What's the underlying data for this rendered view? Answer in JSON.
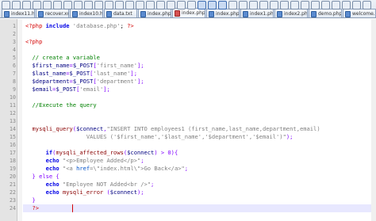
{
  "tabs": [
    {
      "label": "index11.html",
      "active": false,
      "icon": "file-icon"
    },
    {
      "label": "recover.xml",
      "active": false,
      "icon": "file-icon"
    },
    {
      "label": "index10.html",
      "active": false,
      "icon": "file-icon"
    },
    {
      "label": "data.txt",
      "active": false,
      "icon": "file-icon"
    },
    {
      "label": "index.php",
      "active": false,
      "icon": "file-icon"
    },
    {
      "label": "index.php",
      "active": true,
      "icon": "file-icon-modified"
    },
    {
      "label": "index.php",
      "active": false,
      "icon": "file-icon"
    },
    {
      "label": "index1.php",
      "active": false,
      "icon": "file-icon"
    },
    {
      "label": "index2.php",
      "active": false,
      "icon": "file-icon"
    },
    {
      "label": "demo.php",
      "active": false,
      "icon": "file-icon"
    },
    {
      "label": "welcome.php",
      "active": false,
      "icon": "file-icon"
    }
  ],
  "line_numbers": [
    "1",
    "2",
    "3",
    "4",
    "5",
    "6",
    "7",
    "8",
    "9",
    "10",
    "11",
    "12",
    "13",
    "14",
    "15",
    "16",
    "17",
    "18",
    "19",
    "20",
    "21",
    "22",
    "23",
    "24"
  ],
  "code_lines": [
    [
      {
        "t": "<?php ",
        "c": "tag"
      },
      {
        "t": "include ",
        "c": "kw"
      },
      {
        "t": "'database.php'",
        "c": "str"
      },
      {
        "t": "; ",
        "c": ""
      },
      {
        "t": "?>",
        "c": "tag"
      }
    ],
    [],
    [
      {
        "t": "<?php",
        "c": "tag"
      }
    ],
    [],
    [
      {
        "t": "  // create a variable",
        "c": "com"
      }
    ],
    [
      {
        "t": "  $first_name",
        "c": "var"
      },
      {
        "t": "=",
        "c": "op"
      },
      {
        "t": "$_POST",
        "c": "var"
      },
      {
        "t": "[",
        "c": "op"
      },
      {
        "t": "'first_name'",
        "c": "str"
      },
      {
        "t": "];",
        "c": "op"
      }
    ],
    [
      {
        "t": "  $last_name",
        "c": "var"
      },
      {
        "t": "=",
        "c": "op"
      },
      {
        "t": "$_POST",
        "c": "var"
      },
      {
        "t": "[",
        "c": "op"
      },
      {
        "t": "'last_name'",
        "c": "str"
      },
      {
        "t": "];",
        "c": "op"
      }
    ],
    [
      {
        "t": "  $department",
        "c": "var"
      },
      {
        "t": "=",
        "c": "op"
      },
      {
        "t": "$_POST",
        "c": "var"
      },
      {
        "t": "[",
        "c": "op"
      },
      {
        "t": "'department'",
        "c": "str"
      },
      {
        "t": "];",
        "c": "op"
      }
    ],
    [
      {
        "t": "  $email",
        "c": "var"
      },
      {
        "t": "=",
        "c": "op"
      },
      {
        "t": "$_POST",
        "c": "var"
      },
      {
        "t": "[",
        "c": "op"
      },
      {
        "t": "'email'",
        "c": "str"
      },
      {
        "t": "];",
        "c": "op"
      }
    ],
    [],
    [
      {
        "t": "  //Execute the query",
        "c": "com"
      }
    ],
    [],
    [],
    [
      {
        "t": "  mysqli_query",
        "c": "fn"
      },
      {
        "t": "(",
        "c": "op"
      },
      {
        "t": "$connect",
        "c": "var"
      },
      {
        "t": ",",
        "c": "op"
      },
      {
        "t": "\"INSERT INTO employees1 (first_name,last_name,department,email)",
        "c": "str"
      }
    ],
    [
      {
        "t": "                  VALUES ('$first_name','$last_name','$department','$email')\"",
        "c": "str"
      },
      {
        "t": ");",
        "c": "op"
      }
    ],
    [],
    [
      {
        "t": "      if",
        "c": "kw"
      },
      {
        "t": "(",
        "c": "op"
      },
      {
        "t": "mysqli_affected_rows",
        "c": "fn"
      },
      {
        "t": "(",
        "c": "op"
      },
      {
        "t": "$connect",
        "c": "var"
      },
      {
        "t": ") > 0){",
        "c": "op"
      }
    ],
    [
      {
        "t": "      echo ",
        "c": "kw"
      },
      {
        "t": "\"<p>Employee Added</p>\"",
        "c": "str"
      },
      {
        "t": ";",
        "c": "op"
      }
    ],
    [
      {
        "t": "      echo ",
        "c": "kw"
      },
      {
        "t": "\"<a ",
        "c": "str"
      },
      {
        "t": "href",
        "c": "html"
      },
      {
        "t": "=\\\"index.html\\\">Go Back</a>\"",
        "c": "str"
      },
      {
        "t": ";",
        "c": "op"
      }
    ],
    [
      {
        "t": "  } else {",
        "c": "op"
      }
    ],
    [
      {
        "t": "      echo ",
        "c": "kw"
      },
      {
        "t": "\"Employee NOT Added<br />\"",
        "c": "str"
      },
      {
        "t": ";",
        "c": "op"
      }
    ],
    [
      {
        "t": "      echo ",
        "c": "kw"
      },
      {
        "t": "mysqli_error ",
        "c": "fn"
      },
      {
        "t": "(",
        "c": "op"
      },
      {
        "t": "$connect",
        "c": "var"
      },
      {
        "t": ");",
        "c": "op"
      }
    ],
    [
      {
        "t": "  }",
        "c": "op"
      }
    ],
    [
      {
        "t": "  ?>",
        "c": "tag"
      }
    ]
  ],
  "editor": {
    "current_line": 24
  },
  "colors": {
    "tag": "#d40000",
    "keyword": "#0000e6",
    "function": "#8a0000",
    "variable": "#000080",
    "string": "#808080",
    "comment": "#008000",
    "operator": "#8000ff",
    "current_line": "#e8e8ff"
  }
}
